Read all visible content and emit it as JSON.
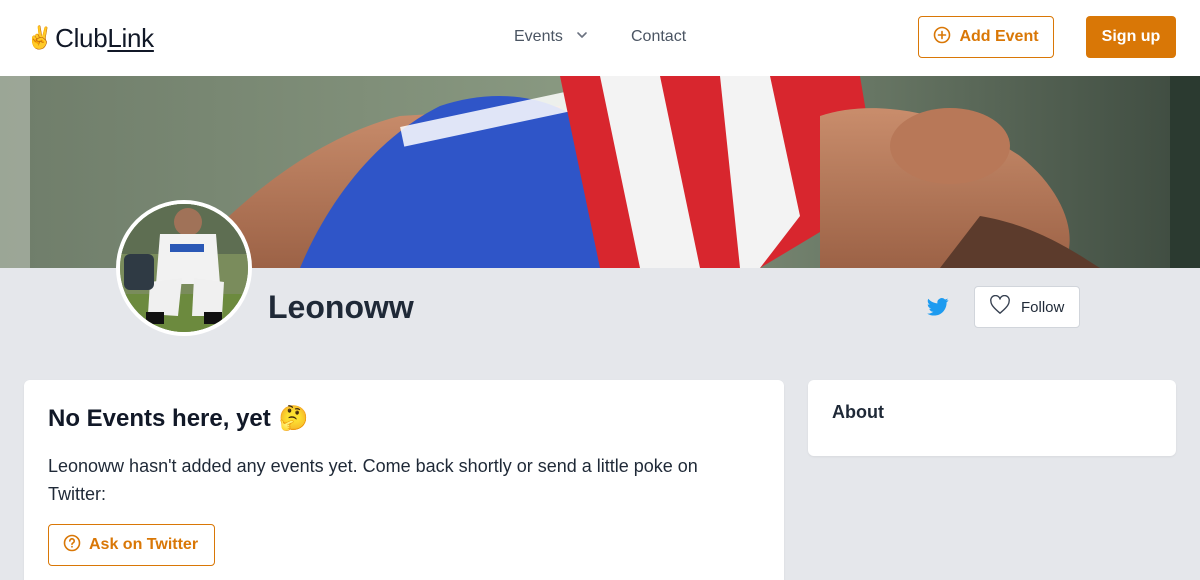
{
  "header": {
    "logo": {
      "emoji": "✌️",
      "text_club": "Club",
      "text_link": "Link"
    },
    "nav": {
      "events_label": "Events",
      "contact_label": "Contact"
    },
    "add_event_label": "Add Event",
    "signup_label": "Sign up"
  },
  "profile": {
    "username": "Leonoww",
    "follow_label": "Follow"
  },
  "main": {
    "empty_title": "No Events here, yet",
    "empty_emoji": "🤔",
    "empty_text": "Leonoww hasn't added any events yet. Come back shortly or send a little poke on Twitter:",
    "ask_button_label": "Ask on Twitter"
  },
  "sidebar": {
    "about_title": "About"
  },
  "colors": {
    "accent": "#d97706",
    "twitter": "#1d9bf0",
    "background": "#e5e7eb"
  },
  "icons": {
    "events_dropdown": "chevron-down-icon",
    "add_event": "plus-circle-icon",
    "twitter": "twitter-icon",
    "follow": "heart-icon",
    "ask": "question-circle-icon"
  }
}
